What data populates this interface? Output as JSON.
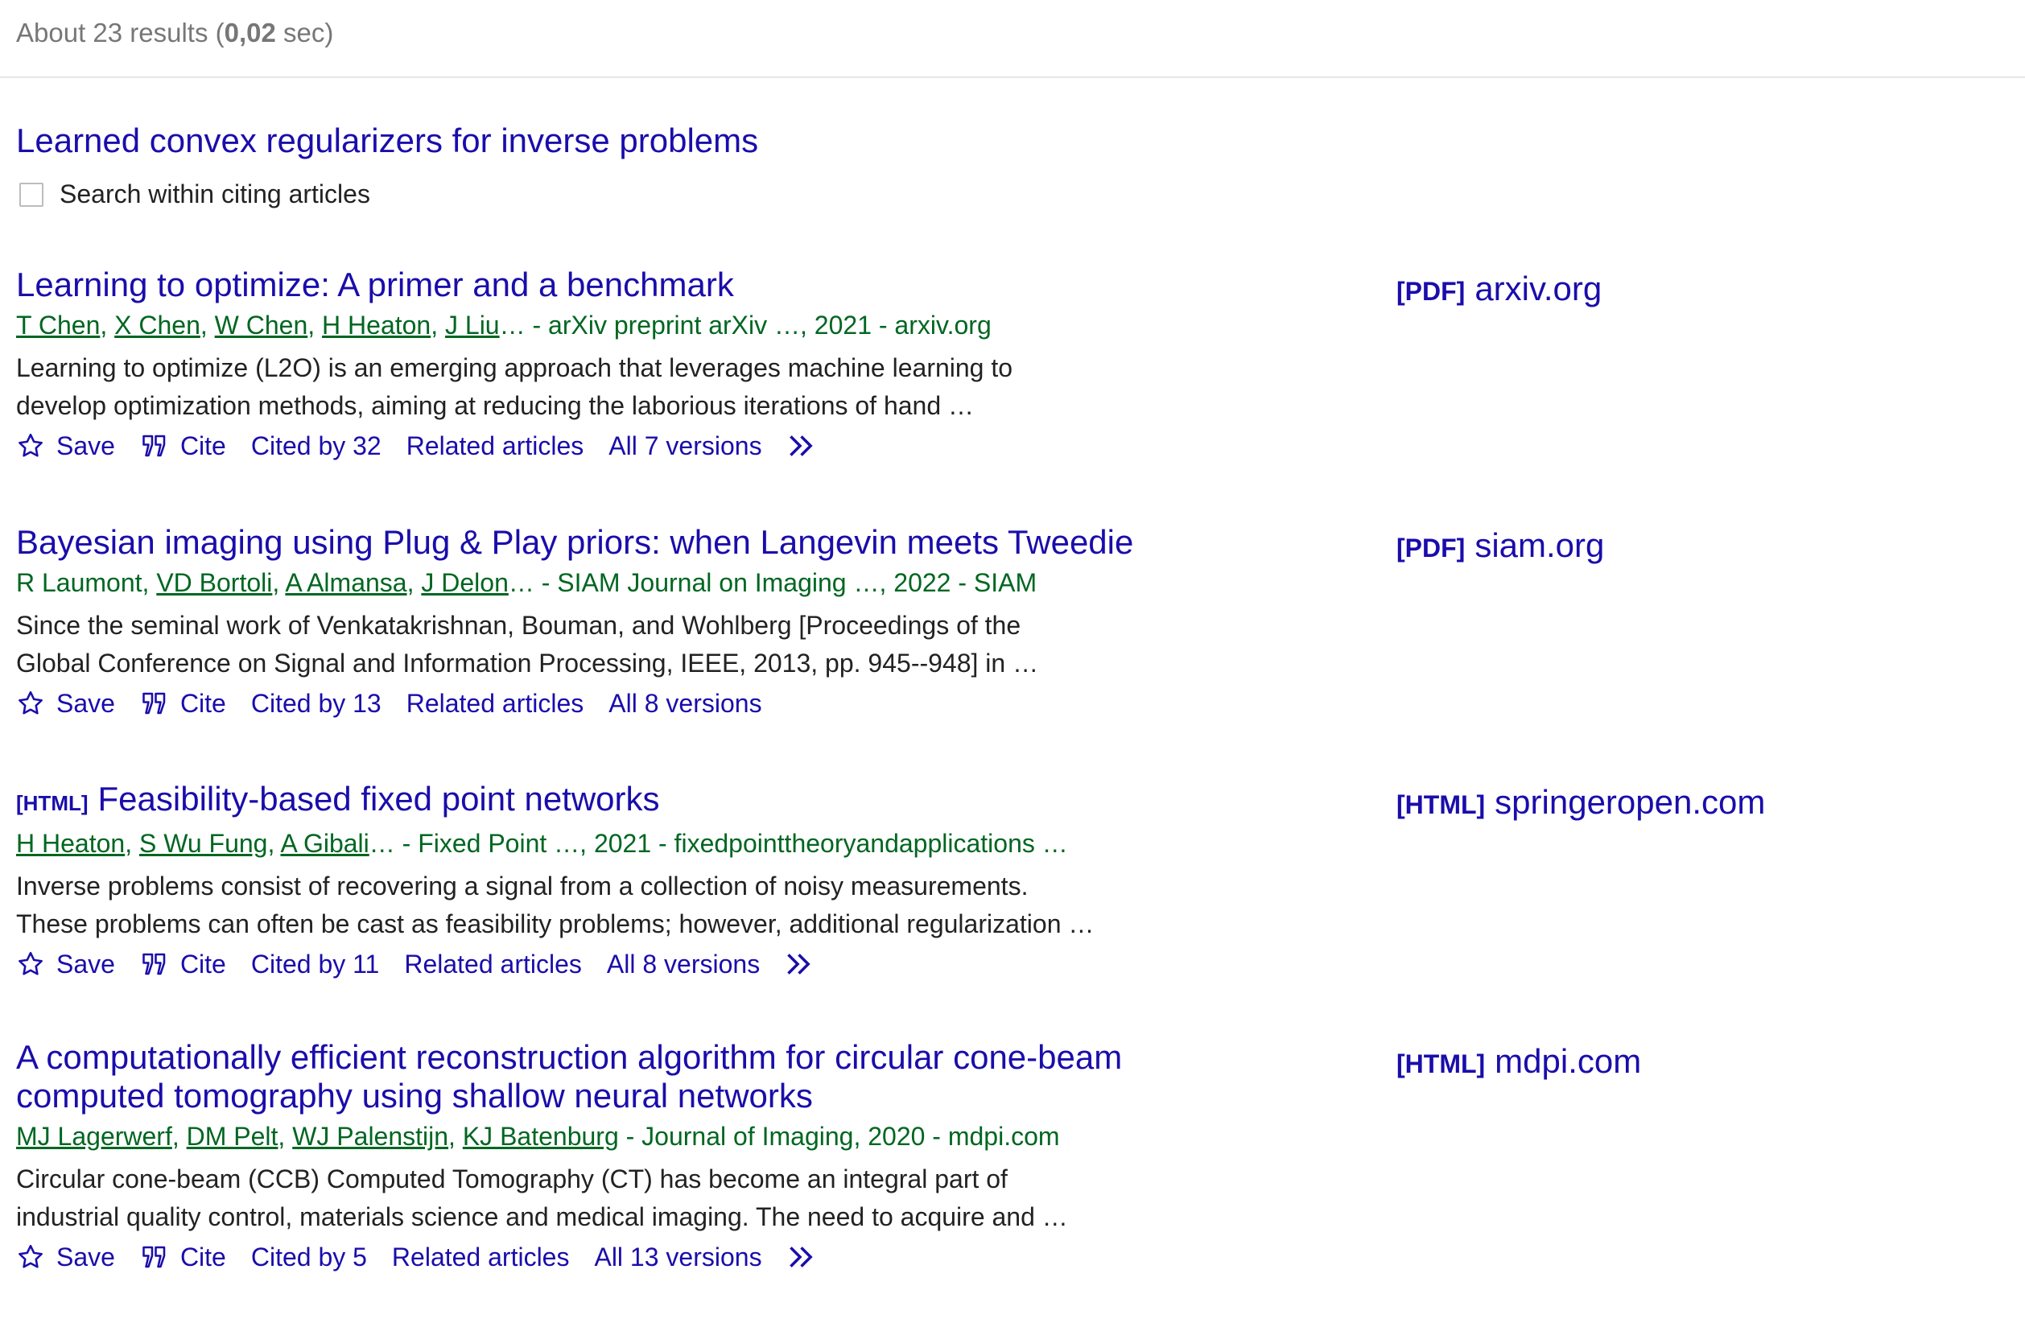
{
  "header": {
    "results_prefix": "About 23 results (",
    "results_time": "0,02",
    "results_suffix": " sec)"
  },
  "cited_article": {
    "title": "Learned convex regularizers for inverse problems",
    "search_within_label": "Search within citing articles"
  },
  "icons": {
    "save": "star-outline-icon",
    "cite": "quote-icon",
    "more": "double-chevron-right-icon"
  },
  "colors": {
    "link": "#1a0dab",
    "meta_green": "#006621",
    "text": "#222222",
    "muted": "#777777"
  },
  "results": [
    {
      "type_tag": "",
      "title": "Learning to optimize: A primer and a benchmark",
      "authors": [
        "T Chen",
        "X Chen",
        "W Chen",
        "H Heaton",
        "J Liu"
      ],
      "authors_linked": [
        true,
        true,
        true,
        true,
        true
      ],
      "source": "… - arXiv preprint arXiv …, 2021 - arxiv.org",
      "snippet_line1": "Learning to optimize (L2O) is an emerging approach that leverages machine learning to",
      "snippet_line2": "develop optimization methods, aiming at reducing the laborious iterations of hand …",
      "save_label": "Save",
      "cite_label": "Cite",
      "cited_by": "Cited by 32",
      "related": "Related articles",
      "versions": "All 7 versions",
      "has_more": true,
      "side_tag": "[PDF]",
      "side_domain": "arxiv.org"
    },
    {
      "type_tag": "",
      "title": "Bayesian imaging using Plug & Play priors: when Langevin meets Tweedie",
      "authors": [
        "R Laumont",
        "VD Bortoli",
        "A Almansa",
        "J Delon"
      ],
      "authors_linked": [
        false,
        true,
        true,
        true
      ],
      "source": "… - SIAM Journal on Imaging …, 2022 - SIAM",
      "snippet_line1": "Since the seminal work of Venkatakrishnan, Bouman, and Wohlberg [Proceedings of the",
      "snippet_line2": "Global Conference on Signal and Information Processing, IEEE, 2013, pp. 945--948] in …",
      "save_label": "Save",
      "cite_label": "Cite",
      "cited_by": "Cited by 13",
      "related": "Related articles",
      "versions": "All 8 versions",
      "has_more": false,
      "side_tag": "[PDF]",
      "side_domain": "siam.org"
    },
    {
      "type_tag": "[HTML]",
      "title": "Feasibility-based fixed point networks",
      "authors": [
        "H Heaton",
        "S Wu Fung",
        "A Gibali"
      ],
      "authors_linked": [
        true,
        true,
        true
      ],
      "source": "… - Fixed Point …, 2021 - fixedpointtheoryandapplications …",
      "snippet_line1": "Inverse problems consist of recovering a signal from a collection of noisy measurements.",
      "snippet_line2": "These problems can often be cast as feasibility problems; however, additional regularization …",
      "save_label": "Save",
      "cite_label": "Cite",
      "cited_by": "Cited by 11",
      "related": "Related articles",
      "versions": "All 8 versions",
      "has_more": true,
      "side_tag": "[HTML]",
      "side_domain": "springeropen.com"
    },
    {
      "type_tag": "",
      "title": "A computationally efficient reconstruction algorithm for circular cone-beam computed tomography using shallow neural networks",
      "authors": [
        "MJ Lagerwerf",
        "DM Pelt",
        "WJ Palenstijn",
        "KJ Batenburg"
      ],
      "authors_linked": [
        true,
        true,
        true,
        true
      ],
      "source": " - Journal of Imaging, 2020 - mdpi.com",
      "snippet_line1": "Circular cone-beam (CCB) Computed Tomography (CT) has become an integral part of",
      "snippet_line2": "industrial quality control, materials science and medical imaging. The need to acquire and …",
      "save_label": "Save",
      "cite_label": "Cite",
      "cited_by": "Cited by 5",
      "related": "Related articles",
      "versions": "All 13 versions",
      "has_more": true,
      "side_tag": "[HTML]",
      "side_domain": "mdpi.com"
    }
  ]
}
